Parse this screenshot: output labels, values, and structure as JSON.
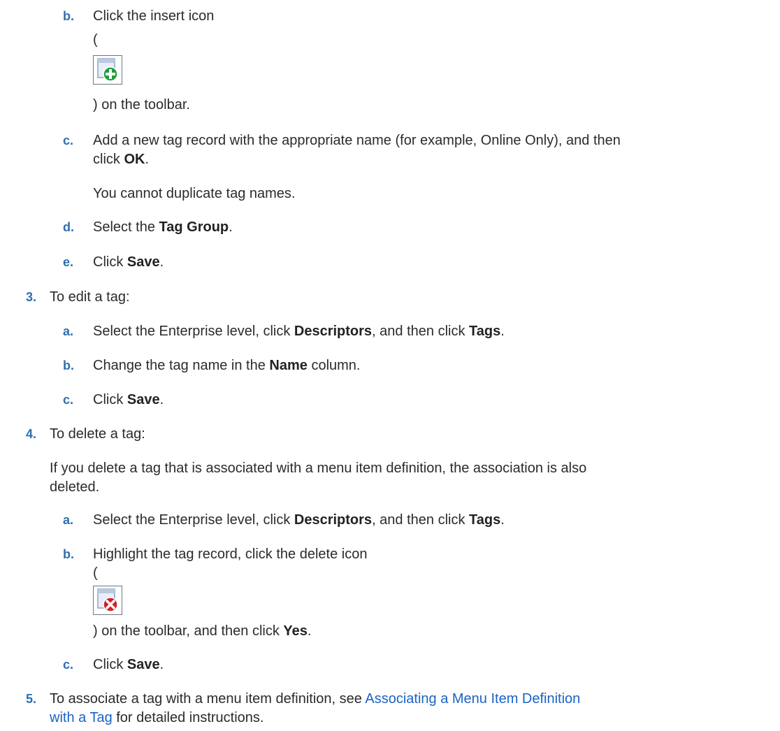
{
  "steps": {
    "b1": {
      "label": "b.",
      "text": "Click the insert icon",
      "open_paren": "(",
      "tail": ") on the toolbar."
    },
    "c1": {
      "label": "c.",
      "text_pre": "Add a new tag record with the appropriate name (for example, Online Only), and then",
      "line2_pre": "click ",
      "bold": "OK",
      "line2_post": "."
    },
    "note1": "You cannot duplicate tag names.",
    "d1": {
      "label": "d.",
      "pre": "Select the ",
      "bold": "Tag Group",
      "post": "."
    },
    "e1": {
      "label": "e.",
      "pre": "Click ",
      "bold": "Save",
      "post": "."
    },
    "s3": {
      "label": "3.",
      "text": "To edit a tag:"
    },
    "s3a": {
      "label": "a.",
      "pre": "Select the Enterprise level, click ",
      "bold1": "Descriptors",
      "mid": ", and then click ",
      "bold2": "Tags",
      "post": "."
    },
    "s3b": {
      "label": "b.",
      "pre": "Change the tag name in the ",
      "bold": "Name",
      "post": " column."
    },
    "s3c": {
      "label": "c.",
      "pre": "Click ",
      "bold": "Save",
      "post": "."
    },
    "s4": {
      "label": "4.",
      "text": "To delete a tag:"
    },
    "s4note": {
      "line1": "If you delete a tag that is associated with a menu item definition, the association is also",
      "line2": "deleted."
    },
    "s4a": {
      "label": "a.",
      "pre": "Select the Enterprise level, click ",
      "bold1": "Descriptors",
      "mid": ", and then click ",
      "bold2": "Tags",
      "post": "."
    },
    "s4b": {
      "label": "b.",
      "text": "Highlight the tag record, click the delete icon",
      "open_paren": "(",
      "tail_pre": ") on the toolbar, and then click ",
      "bold": "Yes",
      "tail_post": "."
    },
    "s4c": {
      "label": "c.",
      "pre": "Click ",
      "bold": "Save",
      "post": "."
    },
    "s5": {
      "label": "5.",
      "pre": "To associate a tag with a menu item definition, see ",
      "link_line1": "Associating a Menu Item Definition",
      "link_line2": "with a Tag",
      "post": " for detailed instructions."
    }
  },
  "icons": {
    "insert": "insert-icon",
    "delete": "delete-icon"
  },
  "colors": {
    "step_number": "#2f6fad",
    "link": "#1a63c6",
    "text": "#2b2b2b"
  }
}
